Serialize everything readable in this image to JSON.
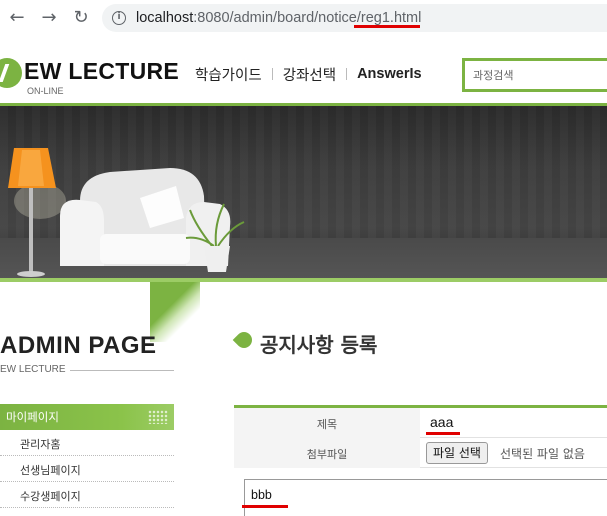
{
  "browser": {
    "url_host": "localhost",
    "url_rest": ":8080/admin/board/notice/reg1.html"
  },
  "header": {
    "logo_text": "EW LECTURE",
    "logo_sub": "ON-LINE",
    "nav": [
      "학습가이드",
      "강좌선택",
      "AnswerIs"
    ],
    "search_placeholder": "과정검색"
  },
  "sidebar": {
    "title": "ADMIN PAGE",
    "subtitle": "EW LECTURE",
    "menu_head": "마이페이지",
    "items": [
      {
        "label": "관리자홈"
      },
      {
        "label": "선생님페이지"
      },
      {
        "label": "수강생페이지"
      }
    ]
  },
  "main": {
    "page_title": "공지사항 등록",
    "form": {
      "title_label": "제목",
      "title_value": "aaa",
      "file_label": "첨부파일",
      "file_button": "파일 선택",
      "file_status": "선택된 파일 없음",
      "content_value": "bbb"
    }
  },
  "colors": {
    "accent": "#7cb342",
    "annotation": "#e00000"
  }
}
